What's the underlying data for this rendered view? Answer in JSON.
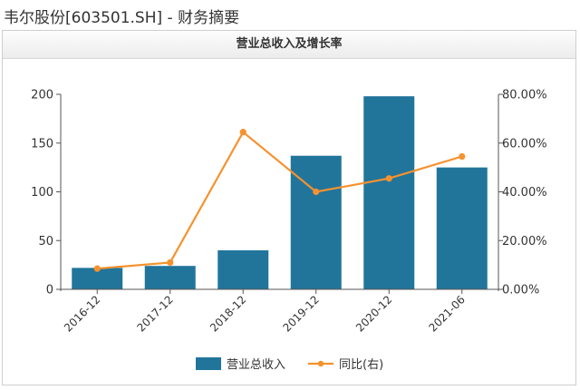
{
  "page": {
    "title": "韦尔股份[603501.SH] - 财务摘要"
  },
  "panel": {
    "header": "营业总收入及增长率"
  },
  "colors": {
    "bar": "#21759b",
    "line": "#f5922f",
    "axis": "#555555",
    "text": "#333333"
  },
  "chart_data": {
    "type": "bar",
    "title": "营业总收入及增长率",
    "categories": [
      "2016-12",
      "2017-12",
      "2018-12",
      "2019-12",
      "2020-12",
      "2021-06"
    ],
    "series": [
      {
        "name": "营业总收入",
        "type": "bar",
        "axis": "left",
        "values": [
          22,
          24,
          40,
          137,
          198,
          125
        ]
      },
      {
        "name": "同比(右)",
        "type": "line",
        "axis": "right",
        "values": [
          8.5,
          11.0,
          64.5,
          40.0,
          45.5,
          54.5
        ]
      }
    ],
    "yleft": {
      "ylim": [
        0,
        200
      ],
      "ticks": [
        0,
        50,
        100,
        150,
        200
      ],
      "tick_labels": [
        "0",
        "50",
        "100",
        "150",
        "200"
      ]
    },
    "yright": {
      "ylim": [
        0,
        80
      ],
      "ticks": [
        0,
        20,
        40,
        60,
        80
      ],
      "tick_labels": [
        "0.00%",
        "20.00%",
        "40.00%",
        "60.00%",
        "80.00%"
      ]
    },
    "grid": false,
    "legend": {
      "position": "bottom",
      "entries": [
        "营业总收入",
        "同比(右)"
      ]
    }
  }
}
